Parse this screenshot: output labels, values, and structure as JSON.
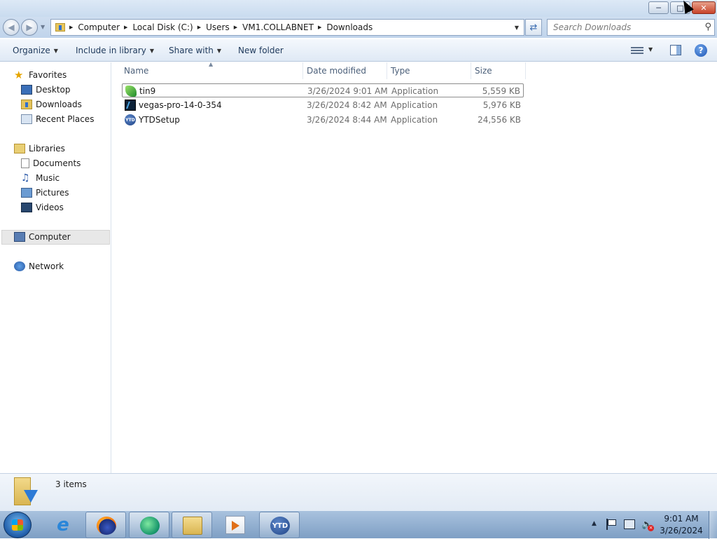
{
  "address": {
    "crumbs": [
      "Computer",
      "Local Disk (C:)",
      "Users",
      "VM1.COLLABNET",
      "Downloads"
    ]
  },
  "search": {
    "placeholder": "Search Downloads"
  },
  "toolbar": {
    "organize": "Organize",
    "include_in_library": "Include in library",
    "share_with": "Share with",
    "new_folder": "New folder",
    "help": "?"
  },
  "nav": {
    "favorites": "Favorites",
    "desktop": "Desktop",
    "downloads": "Downloads",
    "recent_places": "Recent Places",
    "libraries": "Libraries",
    "documents": "Documents",
    "music": "Music",
    "pictures": "Pictures",
    "videos": "Videos",
    "computer": "Computer",
    "network": "Network"
  },
  "columns": {
    "name": "Name",
    "date_modified": "Date modified",
    "type": "Type",
    "size": "Size"
  },
  "files": [
    {
      "name": "tin9",
      "date": "3/26/2024 9:01 AM",
      "type": "Application",
      "size": "5,559 KB",
      "icon": "tin9-icon"
    },
    {
      "name": "vegas-pro-14-0-354",
      "date": "3/26/2024 8:42 AM",
      "type": "Application",
      "size": "5,976 KB",
      "icon": "vegas-icon"
    },
    {
      "name": "YTDSetup",
      "date": "3/26/2024 8:44 AM",
      "type": "Application",
      "size": "24,556 KB",
      "icon": "ytd-icon"
    }
  ],
  "details": {
    "item_count": "3 items"
  },
  "taskbar": {
    "ytd_label": "YTD",
    "clock_time": "9:01 AM",
    "clock_date": "3/26/2024",
    "ie_glyph": "e"
  },
  "file_icons": {
    "ytd_small": "YTD"
  }
}
